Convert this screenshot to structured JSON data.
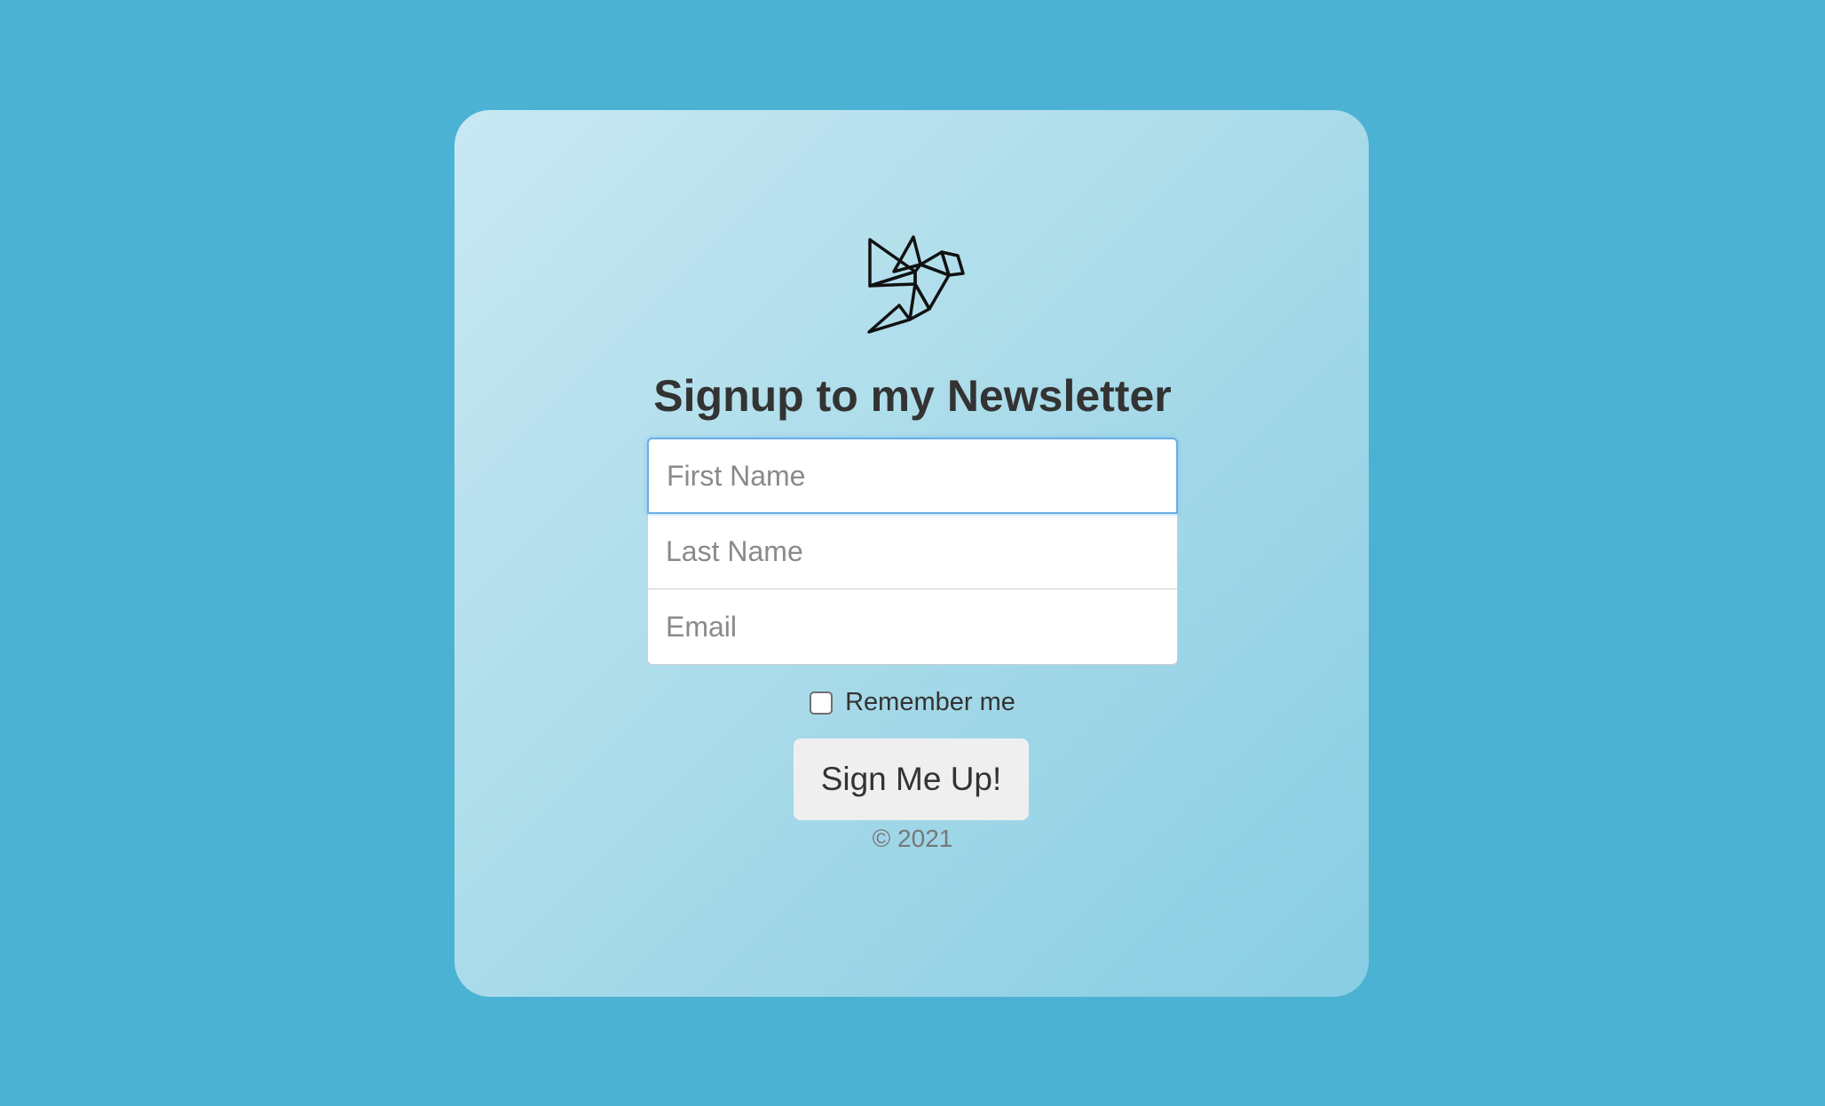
{
  "page": {
    "background_color": "#4bb2d4"
  },
  "logo": {
    "icon": "origami-bird-icon"
  },
  "heading": "Signup to my Newsletter",
  "form": {
    "first_name_placeholder": "First Name",
    "last_name_placeholder": "Last Name",
    "email_placeholder": "Email",
    "focused_field": "First Name",
    "remember_label": "Remember me",
    "remember_checked": false,
    "submit_label": "Sign Me Up!"
  },
  "footer": "© 2021",
  "colors": {
    "focus_border": "#6aaee8",
    "heading_text": "#333333",
    "button_bg": "#efefef"
  }
}
